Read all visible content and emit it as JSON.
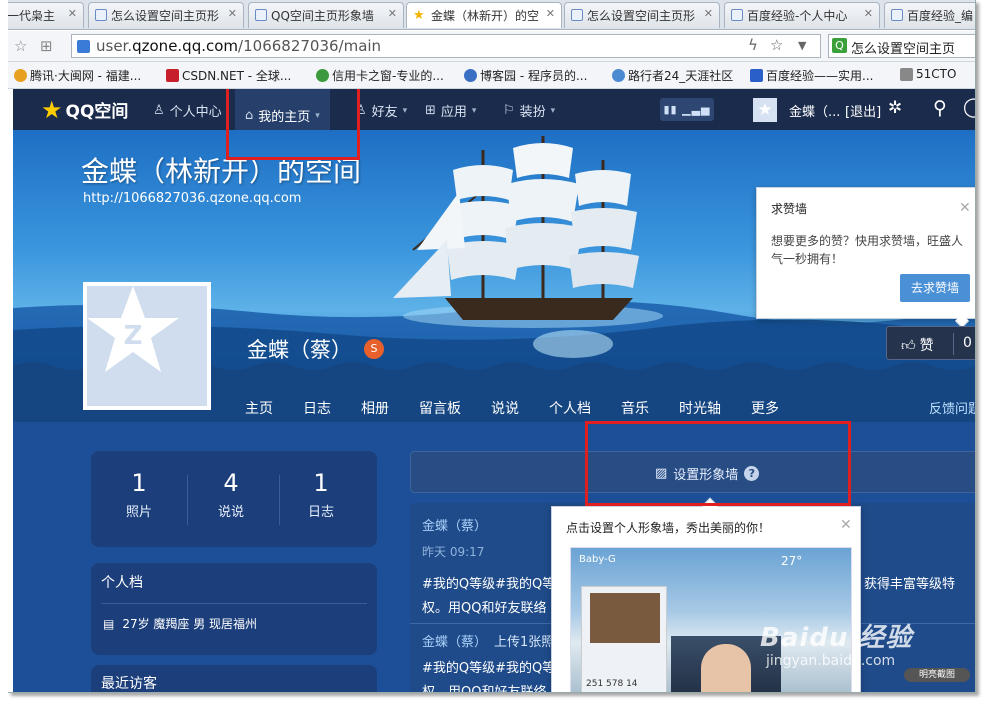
{
  "browser": {
    "tabs": [
      {
        "label": "一代枭主",
        "active": false
      },
      {
        "label": "怎么设置空间主页形",
        "active": false
      },
      {
        "label": "QQ空间主页形象墙",
        "active": false
      },
      {
        "label": "金蝶（林新开）的空",
        "active": true
      },
      {
        "label": "怎么设置空间主页形",
        "active": false
      },
      {
        "label": "百度经验-个人中心",
        "active": false
      },
      {
        "label": "百度经验_编",
        "active": false
      }
    ],
    "url_prefix": "user.",
    "url_domain": "qzone.qq.com",
    "url_path": "/1066827036/main",
    "search_value": "怎么设置空间主页",
    "bookmarks": [
      {
        "label": "腾讯·大闽网 - 福建...",
        "color": "#e8a020"
      },
      {
        "label": "CSDN.NET - 全球...",
        "color": "#c8202a"
      },
      {
        "label": "信用卡之窗-专业的...",
        "color": "#3b9a3b"
      },
      {
        "label": "博客园 - 程序员的...",
        "color": "#3b6fc4"
      },
      {
        "label": "路行者24_天涯社区",
        "color": "#4a8ad0"
      },
      {
        "label": "百度经验——实用...",
        "color": "#2a5fc9"
      },
      {
        "label": "51CTO",
        "color": "#888888"
      }
    ]
  },
  "topnav": {
    "logo": "QQ空间",
    "items": [
      {
        "label": "个人中心",
        "icon": "person-icon",
        "caret": false
      },
      {
        "label": "我的主页",
        "icon": "home-icon",
        "caret": true,
        "active": true
      },
      {
        "label": "好友",
        "icon": "friends-icon",
        "caret": true
      },
      {
        "label": "应用",
        "icon": "grid-icon",
        "caret": true
      },
      {
        "label": "装扮",
        "icon": "shirt-icon",
        "caret": true
      }
    ],
    "user_short": "金蝶（...",
    "logout": "[退出]"
  },
  "banner": {
    "space_title": "金蝶（林新开）的空间",
    "space_url": "http://1066827036.qzone.qq.com",
    "owner_name": "金蝶（蔡）",
    "profile_tabs": [
      "主页",
      "日志",
      "相册",
      "留言板",
      "说说",
      "个人档",
      "音乐",
      "时光轴",
      "更多"
    ],
    "feedback": "反馈问题"
  },
  "praise_popup": {
    "title": "求赞墙",
    "desc": "想要更多的赞？快用求赞墙，旺盛人气一秒拥有！",
    "button": "去求赞墙"
  },
  "like": {
    "label": "赞",
    "count": "0"
  },
  "stats": [
    {
      "value": "1",
      "label": "照片"
    },
    {
      "value": "4",
      "label": "说说"
    },
    {
      "value": "1",
      "label": "日志"
    }
  ],
  "profile": {
    "heading": "个人档",
    "info": "27岁 魔羯座 男 现居福州"
  },
  "visitors": {
    "heading": "最近访客"
  },
  "image_wall": {
    "label": "设置形象墙",
    "help": "?",
    "popup_title": "点击设置个人形象墙，秀出美丽的你！",
    "preview_name": "Baby-G",
    "preview_temp": "27°",
    "preview_stats": "251   578   14"
  },
  "feed": {
    "name1": "金蝶（蔡）",
    "time1": "昨天 09:17",
    "text1": "#我的Q等级#我的Q等",
    "text1_right": "获得丰富等级特",
    "text2": "权。用QQ和好友联络",
    "name2": "金蝶（蔡）",
    "action2": "上传1张照",
    "text3": "#我的Q等级#我的Q等",
    "text4": "权。用QQ和好友联络"
  },
  "watermark": {
    "brand": "Baidu 经验",
    "sub": "jingyan.baidu.com",
    "tag": "明亮截图"
  }
}
